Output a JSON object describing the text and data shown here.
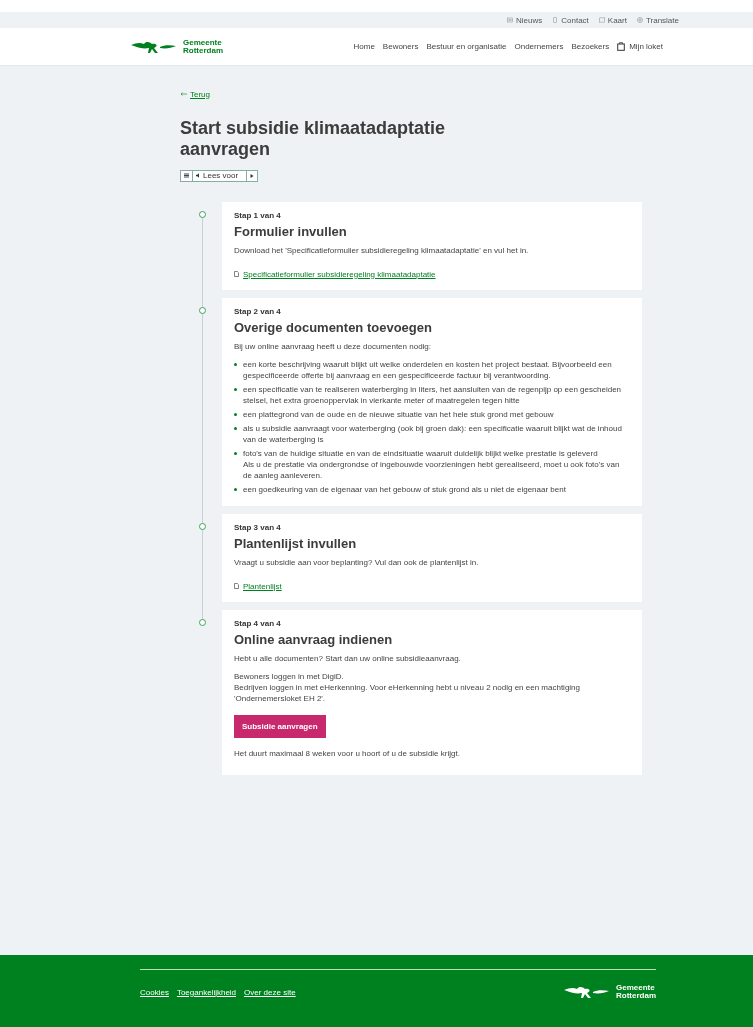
{
  "utility_links": [
    {
      "kind": "news",
      "label": "Nieuws"
    },
    {
      "kind": "phone",
      "label": "Contact"
    },
    {
      "kind": "map",
      "label": "Kaart"
    },
    {
      "kind": "globe",
      "label": "Translate"
    }
  ],
  "header": {
    "logo_text": [
      "Gemeente",
      "Rotterdam"
    ],
    "nav": [
      "Home",
      "Bewoners",
      "Bestuur en organisatie",
      "Ondernemers",
      "Bezoekers"
    ],
    "account_link": "Mijn loket"
  },
  "back_link": "Terug",
  "title": "Start subsidie klimaatadaptatie aanvragen",
  "read_speaker": {
    "label": "Lees voor"
  },
  "steps": [
    {
      "step_label": "Stap 1 van 4",
      "title": "Formulier invullen",
      "content": [
        {
          "kind": "paragraph",
          "text": "Download het 'Specificatieformulier subsidieregeling klimaatadaptatie' en vul het in."
        },
        {
          "kind": "file_link",
          "text": "Specificatieformulier subsidieregeling klimaatadaptatie"
        }
      ]
    },
    {
      "step_label": "Stap 2 van 4",
      "title": "Overige documenten toevoegen",
      "content": [
        {
          "kind": "paragraph",
          "text": "Bij uw online aanvraag heeft u deze documenten nodig:"
        },
        {
          "kind": "bullets",
          "items": [
            {
              "text": "een korte beschrijving waaruit blijkt uit welke onderdelen en kosten het project bestaat. Bijvoorbeeld een gespecificeerde offerte bij aanvraag en een gespecificeerde factuur bij verantwoording."
            },
            {
              "text": "een specificatie van te realiseren waterberging in liters, het aansluiten van de regenpijp op een gescheiden stelsel, het extra groenoppervlak in vierkante meter of maatregelen tegen hitte"
            },
            {
              "text": "een plattegrond van de oude en de nieuwe situatie van het hele stuk grond met gebouw"
            },
            {
              "text": "als u subsidie aanvraagt voor waterberging (ook bij groen dak): een specificatie waaruit blijkt wat de inhoud van de waterberging is"
            },
            {
              "text": "foto's van de huidige situatie en van de eindsituatie waaruit duidelijk blijkt welke prestatie is geleverd",
              "extra": "Als u de prestatie via ondergrondse of ingebouwde voorzieningen hebt gerealiseerd, moet u ook foto's van de aanleg aanleveren."
            },
            {
              "text": "een goedkeuring van de eigenaar van het gebouw of stuk grond als u niet de eigenaar bent"
            }
          ]
        }
      ]
    },
    {
      "step_label": "Stap 3 van 4",
      "title": "Plantenlijst invullen",
      "content": [
        {
          "kind": "paragraph",
          "text": "Vraagt u subsidie aan voor beplanting? Vul dan ook de plantenlijst in."
        },
        {
          "kind": "file_link",
          "text": "Plantenlijst"
        }
      ]
    },
    {
      "step_label": "Stap 4 van 4",
      "title": "Online aanvraag indienen",
      "content": [
        {
          "kind": "paragraph",
          "text": "Hebt u alle documenten? Start dan uw online subsidieaanvraag."
        },
        {
          "kind": "lines",
          "lines": [
            "Bewoners loggen in met DigiD.",
            "Bedrijven loggen in met eHerkenning. Voor eHerkenning hebt u niveau 2 nodig en een machtiging 'Ondernemersloket EH 2'."
          ]
        },
        {
          "kind": "button",
          "text": "Subsidie aanvragen"
        },
        {
          "kind": "paragraph",
          "text": "Het duurt maximaal 8 weken voor u hoort of u de subsidie krijgt."
        }
      ]
    }
  ],
  "footer": {
    "links": [
      "Cookies",
      "Toegankelijkheid",
      "Over deze site"
    ],
    "logo_text": [
      "Gemeente",
      "Rotterdam"
    ]
  }
}
